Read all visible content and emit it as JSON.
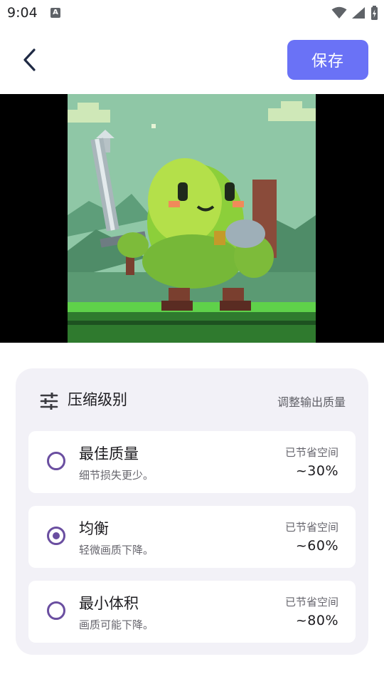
{
  "status_bar": {
    "time": "9:04",
    "icons": [
      "a-icon",
      "wifi-icon",
      "signal-icon",
      "battery-icon"
    ]
  },
  "header": {
    "back_icon": "chevron-left-icon",
    "save_label": "保存"
  },
  "preview": {
    "description_icon": "pixel-art-image"
  },
  "compression": {
    "icon": "tune-icon",
    "title": "压缩级别",
    "subtitle": "调整输出质量",
    "selected_index": 1,
    "options": [
      {
        "title": "最佳质量",
        "desc": "细节损失更少。",
        "saved_label": "已节省空间",
        "saved_value": "~30%"
      },
      {
        "title": "均衡",
        "desc": "轻微画质下降。",
        "saved_label": "已节省空间",
        "saved_value": "~60%"
      },
      {
        "title": "最小体积",
        "desc": "画质可能下降。",
        "saved_label": "已节省空间",
        "saved_value": "~80%"
      }
    ]
  },
  "colors": {
    "accent": "#6a72f6",
    "radio": "#6a4ea0",
    "card_bg": "#f2f1f7"
  }
}
